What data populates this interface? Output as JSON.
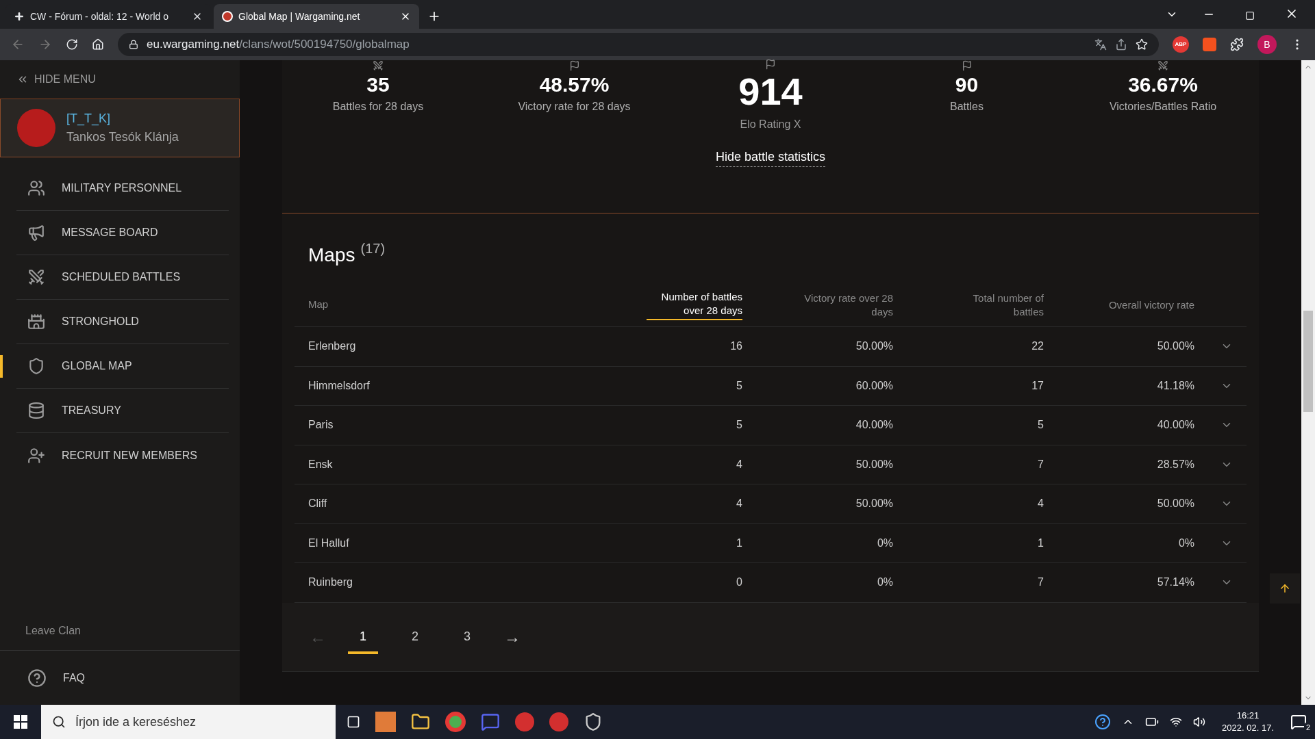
{
  "browser": {
    "tabs": [
      {
        "title": "CW - Fórum - oldal: 12 - World o",
        "selected": false
      },
      {
        "title": "Global Map | Wargaming.net",
        "selected": true
      }
    ],
    "url_host": "eu.wargaming.net",
    "url_path": "/clans/wot/500194750/globalmap",
    "profile_initial": "B",
    "extension_label": "ABP"
  },
  "sidebar": {
    "hide_menu": "HIDE MENU",
    "clan": {
      "tag": "[T_T_K]",
      "name": "Tankos Tesók Klánja"
    },
    "items": [
      {
        "label": "MILITARY PERSONNEL",
        "selected": false
      },
      {
        "label": "MESSAGE BOARD",
        "selected": false
      },
      {
        "label": "SCHEDULED BATTLES",
        "selected": false
      },
      {
        "label": "STRONGHOLD",
        "selected": false
      },
      {
        "label": "GLOBAL MAP",
        "selected": true
      },
      {
        "label": "TREASURY",
        "selected": false
      },
      {
        "label": "RECRUIT NEW MEMBERS",
        "selected": false
      }
    ],
    "leave": "Leave Clan",
    "faq": "FAQ"
  },
  "stats": [
    {
      "value": "35",
      "label": "Battles for 28 days",
      "kind": "small"
    },
    {
      "value": "48.57%",
      "label": "Victory rate for 28 days",
      "kind": "small"
    },
    {
      "value": "914",
      "label": "Elo Rating X",
      "kind": "big"
    },
    {
      "value": "90",
      "label": "Battles",
      "kind": "small"
    },
    {
      "value": "36.67%",
      "label": "Victories/Battles Ratio",
      "kind": "small"
    }
  ],
  "hide_stats": "Hide battle statistics",
  "maps": {
    "title": "Maps",
    "count": "(17)",
    "columns": [
      {
        "label": "Map",
        "selected": false
      },
      {
        "label": "Number of battles over 28 days",
        "selected": true
      },
      {
        "label": "Victory rate over 28 days",
        "selected": false
      },
      {
        "label": "Total number of battles",
        "selected": false
      },
      {
        "label": "Overall victory rate",
        "selected": false
      }
    ],
    "rows": [
      [
        "Erlenberg",
        "16",
        "50.00%",
        "22",
        "50.00%"
      ],
      [
        "Himmelsdorf",
        "5",
        "60.00%",
        "17",
        "41.18%"
      ],
      [
        "Paris",
        "5",
        "40.00%",
        "5",
        "40.00%"
      ],
      [
        "Ensk",
        "4",
        "50.00%",
        "7",
        "28.57%"
      ],
      [
        "Cliff",
        "4",
        "50.00%",
        "4",
        "50.00%"
      ],
      [
        "El Halluf",
        "1",
        "0%",
        "1",
        "0%"
      ],
      [
        "Ruinberg",
        "0",
        "0%",
        "7",
        "57.14%"
      ]
    ],
    "pages": [
      {
        "label": "1",
        "selected": true
      },
      {
        "label": "2",
        "selected": false
      },
      {
        "label": "3",
        "selected": false
      }
    ],
    "prev": "←",
    "next": "→"
  },
  "taskbar": {
    "search_placeholder": "Írjon ide a kereséshez",
    "time": "16:21",
    "date": "2022. 02. 17.",
    "notifications": "2"
  }
}
